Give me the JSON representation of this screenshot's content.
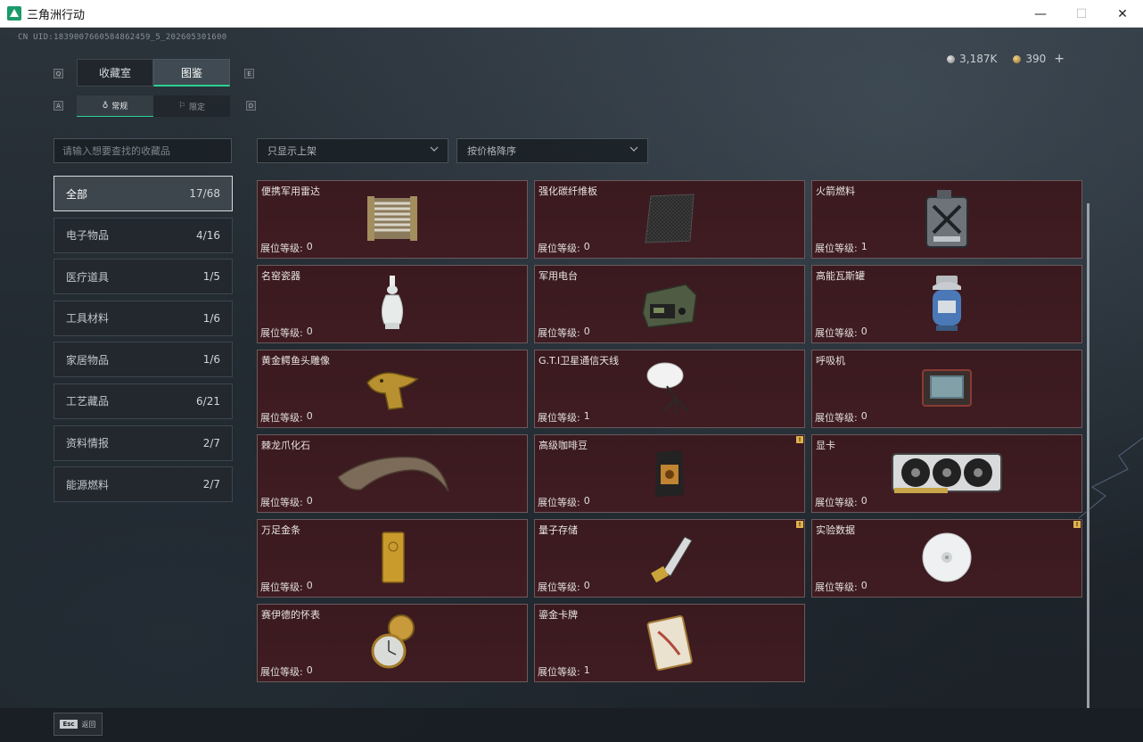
{
  "window": {
    "title": "三角洲行动",
    "minimize": "—",
    "maximize": "☐",
    "close": "✕"
  },
  "uid": "CN UID:1839007660584862459_5_202605301600",
  "currency": {
    "silver": "3,187K",
    "gold": "390",
    "add": "+"
  },
  "tabs_top": {
    "left_key": "Q",
    "right_key": "E",
    "items": [
      "收藏室",
      "图鉴"
    ],
    "active": 1
  },
  "tabs_sub": {
    "left_key": "A",
    "right_key": "D",
    "items": [
      "常规",
      "限定"
    ]
  },
  "search": {
    "placeholder": "请输入想要查找的收藏品"
  },
  "filters": {
    "shelf": "只显示上架",
    "sort": "按价格降序"
  },
  "categories": [
    {
      "label": "全部",
      "count": "17/68"
    },
    {
      "label": "电子物品",
      "count": "4/16"
    },
    {
      "label": "医疗道具",
      "count": "1/5"
    },
    {
      "label": "工具材料",
      "count": "1/6"
    },
    {
      "label": "家居物品",
      "count": "1/6"
    },
    {
      "label": "工艺藏品",
      "count": "6/21"
    },
    {
      "label": "资料情报",
      "count": "2/7"
    },
    {
      "label": "能源燃料",
      "count": "2/7"
    }
  ],
  "level_label": "展位等级:",
  "items": [
    {
      "name": "便携军用雷达",
      "level": "0",
      "icon": "radar-icon"
    },
    {
      "name": "强化碳纤维板",
      "level": "0",
      "icon": "carbon-plate-icon"
    },
    {
      "name": "火箭燃料",
      "level": "1",
      "icon": "fuel-can-icon"
    },
    {
      "name": "名窑瓷器",
      "level": "0",
      "icon": "porcelain-vase-icon"
    },
    {
      "name": "军用电台",
      "level": "0",
      "icon": "military-radio-icon"
    },
    {
      "name": "高能瓦斯罐",
      "level": "0",
      "icon": "gas-canister-icon"
    },
    {
      "name": "黄金鳄鱼头雕像",
      "level": "0",
      "icon": "gold-crocodile-icon"
    },
    {
      "name": "G.T.I卫星通信天线",
      "level": "1",
      "icon": "satellite-dish-icon"
    },
    {
      "name": "呼吸机",
      "level": "0",
      "icon": "ventilator-icon"
    },
    {
      "name": "棘龙爪化石",
      "level": "0",
      "icon": "claw-fossil-icon"
    },
    {
      "name": "高级咖啡豆",
      "level": "0",
      "icon": "coffee-bag-icon",
      "flag": "!"
    },
    {
      "name": "显卡",
      "level": "0",
      "icon": "graphics-card-icon"
    },
    {
      "name": "万足金条",
      "level": "0",
      "icon": "gold-bar-icon"
    },
    {
      "name": "量子存储",
      "level": "0",
      "icon": "quantum-storage-icon",
      "flag": "!"
    },
    {
      "name": "实验数据",
      "level": "0",
      "icon": "data-disc-icon",
      "flag": "!"
    },
    {
      "name": "赛伊德的怀表",
      "level": "0",
      "icon": "pocket-watch-icon"
    },
    {
      "name": "鎏金卡牌",
      "level": "1",
      "icon": "gilded-card-icon"
    }
  ],
  "bottom": {
    "esc_key": "Esc",
    "esc_label": "返回"
  }
}
